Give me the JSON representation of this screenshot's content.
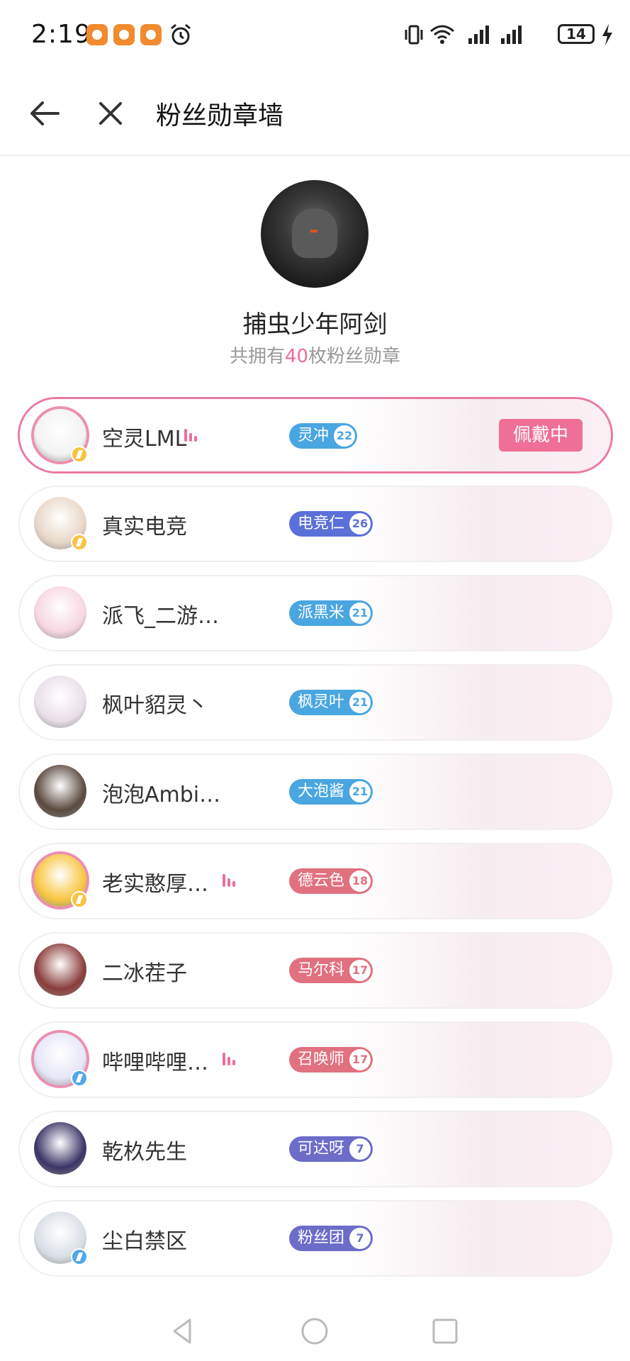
{
  "status_bar": {
    "time": "2:19",
    "battery": "14"
  },
  "header": {
    "title": "粉丝勋章墙",
    "back_icon": "arrow-left-icon",
    "close_icon": "close-icon"
  },
  "profile": {
    "name": "捕虫少年阿剑",
    "count_prefix": "共拥有",
    "count": "40",
    "count_suffix": "枚粉丝勋章"
  },
  "wearing_label": "佩戴中",
  "medals": [
    {
      "name": "空灵LML",
      "badge": "灵冲",
      "level": "22",
      "badge_color": "#4aa6e0",
      "wearing": true,
      "live": true
    },
    {
      "name": "真实电竞",
      "badge": "电竞仁",
      "level": "26",
      "badge_color": "#5b6fd8",
      "wearing": false,
      "live": false
    },
    {
      "name": "派飞_二游…",
      "badge": "派黑米",
      "level": "21",
      "badge_color": "#4aa6e0",
      "wearing": false,
      "live": false
    },
    {
      "name": "枫叶貂灵丶",
      "badge": "枫灵叶",
      "level": "21",
      "badge_color": "#4aa6e0",
      "wearing": false,
      "live": false
    },
    {
      "name": "泡泡Ambi…",
      "badge": "大泡酱",
      "level": "21",
      "badge_color": "#4aa6e0",
      "wearing": false,
      "live": false
    },
    {
      "name": "老实憨厚…",
      "badge": "德云色",
      "level": "18",
      "badge_color": "#e1717f",
      "wearing": false,
      "live": true
    },
    {
      "name": "二冰茬子",
      "badge": "马尔科",
      "level": "17",
      "badge_color": "#e1717f",
      "wearing": false,
      "live": false
    },
    {
      "name": "哔哩哔哩…",
      "badge": "召唤师",
      "level": "17",
      "badge_color": "#e1717f",
      "wearing": false,
      "live": true
    },
    {
      "name": "乾杦先生",
      "badge": "可达呀",
      "level": "7",
      "badge_color": "#6c6cc9",
      "wearing": false,
      "live": false
    },
    {
      "name": "尘白禁区",
      "badge": "粉丝团",
      "level": "7",
      "badge_color": "#6c6cc9",
      "wearing": false,
      "live": false
    }
  ],
  "nav": {
    "back_icon": "triangle-back-icon",
    "home_icon": "circle-home-icon",
    "recent_icon": "square-recents-icon"
  }
}
